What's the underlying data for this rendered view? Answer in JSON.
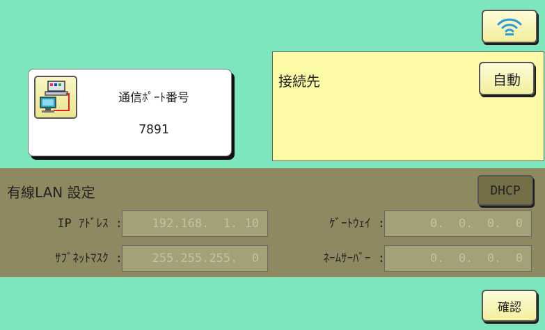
{
  "wifi_button": {
    "icon": "wifi-icon"
  },
  "port": {
    "icon": "network-computers-icon",
    "label": "通信ﾎﾟｰﾄ番号",
    "value": "7891"
  },
  "destination": {
    "label": "接続先",
    "auto_button": "自動"
  },
  "wired_lan": {
    "title": "有線LAN 設定",
    "dhcp_button": "DHCP",
    "ip_address": {
      "label": "IP ｱﾄﾞﾚｽ :",
      "value": "192.168.  1. 10"
    },
    "subnet_mask": {
      "label": "ｻﾌﾞﾈｯﾄﾏｽｸ :",
      "value": "255.255.255.  0"
    },
    "gateway": {
      "label": "ｹﾞｰﾄｳｪｲ :",
      "value": "0.  0.  0.  0"
    },
    "name_server": {
      "label": "ﾈｰﾑｻｰﾊﾞｰ :",
      "value": "0.  0.  0.  0"
    }
  },
  "confirm_button": "確認",
  "colors": {
    "background": "#7de6bd",
    "button_face": "#f2ef9c",
    "panel_yellow": "#fdfaa6",
    "lan_panel": "#8f8962",
    "field_disabled": "#a4a078"
  }
}
